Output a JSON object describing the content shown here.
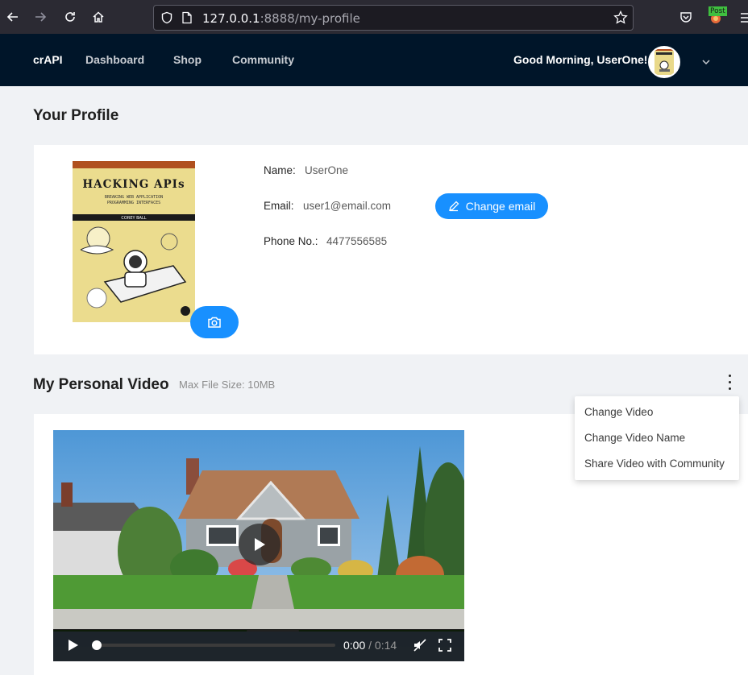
{
  "browser": {
    "url_host": "127.0.0.1",
    "url_path": ":8888/my-profile",
    "extension_badge": "Post"
  },
  "header": {
    "brand": "crAPI",
    "nav": [
      "Dashboard",
      "Shop",
      "Community"
    ],
    "greeting": "Good Morning, UserOne!"
  },
  "profile": {
    "title": "Your Profile",
    "name_label": "Name",
    "name_value": "UserOne",
    "email_label": "Email",
    "email_value": "user1@email.com",
    "phone_label": "Phone No.",
    "phone_value": "4477556585",
    "change_email_label": "Change email",
    "book": {
      "title": "HACKING APIs",
      "subtitle_line1": "BREAKING WEB APPLICATION",
      "subtitle_line2": "PROGRAMMING INTERFACES",
      "author": "COREY BALL"
    }
  },
  "video_section": {
    "title": "My Personal Video",
    "hint": "Max File Size: 10MB",
    "menu": [
      "Change Video",
      "Change Video Name",
      "Share Video with Community"
    ],
    "player": {
      "current_time": "0:00",
      "duration": "/ 0:14",
      "progress": 0
    }
  },
  "colors": {
    "primary": "#1890ff",
    "header_bg": "#001529",
    "page_bg": "#f0f2f5"
  }
}
